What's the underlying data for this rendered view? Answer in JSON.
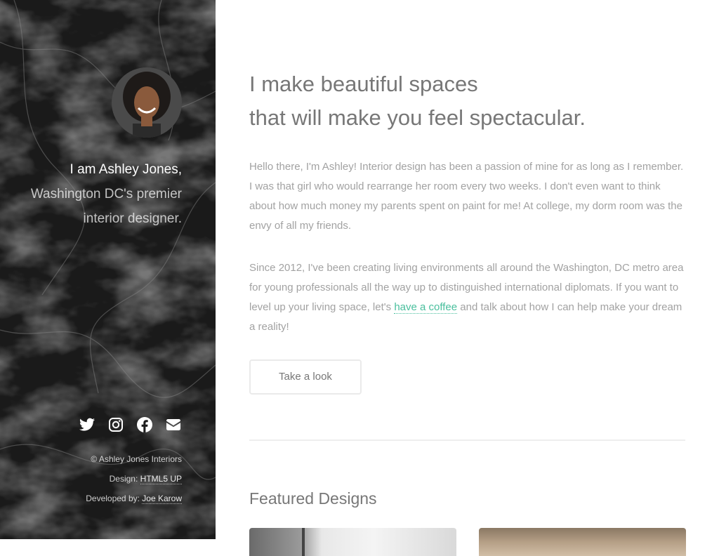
{
  "sidebar": {
    "avatar_alt": "Ashley Jones",
    "intro_name": "I am Ashley Jones,",
    "intro_rest": "Washington DC's premier interior designer.",
    "socials": [
      {
        "name": "twitter-icon"
      },
      {
        "name": "instagram-icon"
      },
      {
        "name": "facebook-icon"
      },
      {
        "name": "envelope-icon"
      }
    ],
    "copyright": "© Ashley Jones Interiors",
    "design_label": "Design:",
    "design_link": "HTML5 UP",
    "developed_label": "Developed by:",
    "developed_link": "Joe Karow"
  },
  "main": {
    "headline_line1": "I make beautiful spaces",
    "headline_line2": "that will make you feel spectacular.",
    "para1": "Hello there, I'm Ashley! Interior design has been a passion of mine for as long as I remember. I was that girl who would rearrange her room every two weeks. I don't even want to think about how much money my parents spent on paint for me! At college, my dorm room was the envy of all my friends.",
    "para2_before": "Since 2012, I've been creating living environments all around the Washington, DC metro area for young professionals all the way up to distinguished international diplomats. If you want to level up your living space, let's ",
    "para2_link": "have a coffee",
    "para2_after": " and talk about how I can help make your dream a reality!",
    "button_label": "Take a look",
    "featured_title": "Featured Designs"
  },
  "colors": {
    "accent": "#49bf9d",
    "heading": "#777777",
    "body_text": "#a2a2a2",
    "sidebar_bg": "#1c1c1c"
  }
}
